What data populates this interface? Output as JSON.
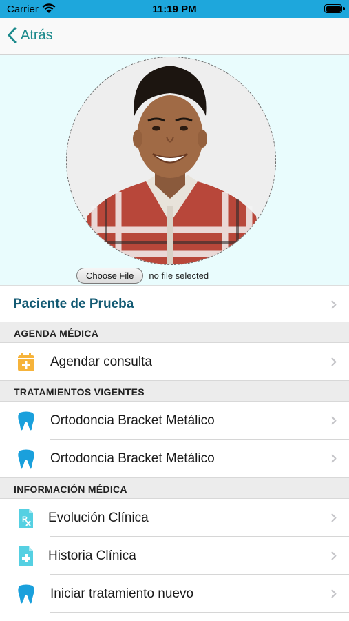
{
  "status_bar": {
    "carrier": "Carrier",
    "time": "11:19 PM"
  },
  "nav": {
    "back_label": "Atrás"
  },
  "photo": {
    "choose_file_label": "Choose File",
    "file_status": "no file selected"
  },
  "patient": {
    "name": "Paciente de Prueba"
  },
  "sections": {
    "agenda": {
      "title": "AGENDA MÉDICA",
      "items": [
        {
          "label": "Agendar consulta",
          "icon": "calendar-plus-icon"
        }
      ]
    },
    "treatments": {
      "title": "TRATAMIENTOS VIGENTES",
      "items": [
        {
          "label": "Ortodoncia Bracket Metálico",
          "icon": "tooth-icon"
        },
        {
          "label": "Ortodoncia Bracket Metálico",
          "icon": "tooth-icon"
        }
      ]
    },
    "medical_info": {
      "title": "INFORMACIÓN MÉDICA",
      "items": [
        {
          "label": "Evolución Clínica",
          "icon": "prescription-document-icon"
        },
        {
          "label": "Historia Clínica",
          "icon": "medical-document-icon"
        },
        {
          "label": "Iniciar tratamiento nuevo",
          "icon": "tooth-icon"
        }
      ]
    }
  },
  "colors": {
    "status_bar": "#1ea7dc",
    "accent": "#1c8a8c",
    "patient_name": "#135a73",
    "tooth": "#1aa0dc",
    "calendar": "#f6b33a",
    "document": "#55d0e2"
  }
}
